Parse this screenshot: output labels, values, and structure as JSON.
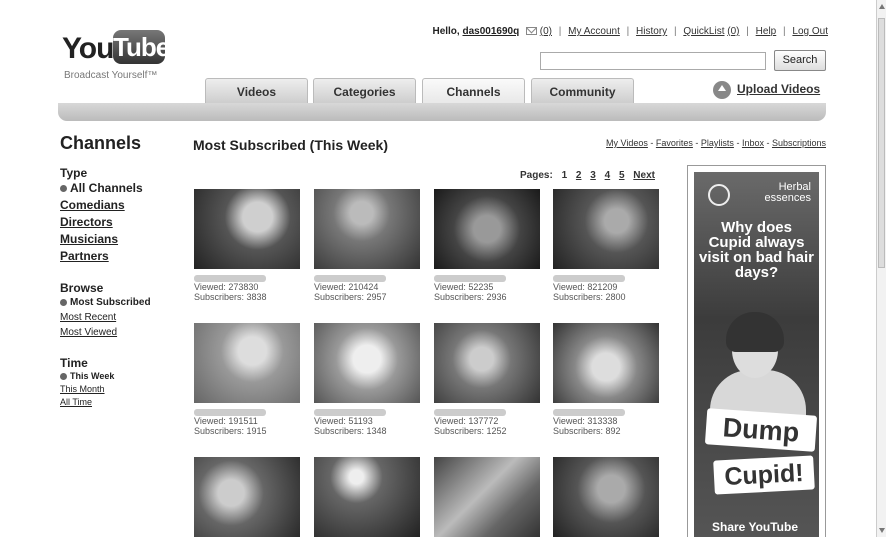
{
  "logo": {
    "you": "You",
    "tube": "Tube",
    "tagline": "Broadcast Yourself™"
  },
  "userbar": {
    "hello": "Hello,",
    "username": "das001690q",
    "inbox_count": "(0)",
    "my_account": "My Account",
    "history": "History",
    "quicklist": "QuickList",
    "quicklist_count": "(0)",
    "help": "Help",
    "logout": "Log Out"
  },
  "search": {
    "value": "",
    "button": "Search"
  },
  "tabs": [
    "Videos",
    "Categories",
    "Channels",
    "Community"
  ],
  "upload": "Upload Videos",
  "page_title": "Channels",
  "section_title": "Most Subscribed (This Week)",
  "sub_links": [
    "My Videos",
    "Favorites",
    "Playlists",
    "Inbox",
    "Subscriptions"
  ],
  "sidebar": {
    "type_head": "Type",
    "type_items": [
      "All Channels",
      "Comedians",
      "Directors",
      "Musicians",
      "Partners"
    ],
    "browse_head": "Browse",
    "browse_items": [
      "Most Subscribed",
      "Most Recent",
      "Most Viewed"
    ],
    "time_head": "Time",
    "time_items": [
      "This Week",
      "This Month",
      "All Time"
    ]
  },
  "pages": {
    "label": "Pages:",
    "items": [
      "1",
      "2",
      "3",
      "4",
      "5"
    ],
    "next": "Next"
  },
  "channels": [
    {
      "viewed": "Viewed: 273830",
      "subs": "Subscribers: 3838"
    },
    {
      "viewed": "Viewed: 210424",
      "subs": "Subscribers: 2957"
    },
    {
      "viewed": "Viewed: 52235",
      "subs": "Subscribers: 2936"
    },
    {
      "viewed": "Viewed: 821209",
      "subs": "Subscribers: 2800"
    },
    {
      "viewed": "Viewed: 191511",
      "subs": "Subscribers: 1915"
    },
    {
      "viewed": "Viewed: 51193",
      "subs": "Subscribers: 1348"
    },
    {
      "viewed": "Viewed: 137772",
      "subs": "Subscribers: 1252"
    },
    {
      "viewed": "Viewed: 313338",
      "subs": "Subscribers: 892"
    },
    {
      "viewed": "",
      "subs": ""
    },
    {
      "viewed": "",
      "subs": ""
    },
    {
      "viewed": "",
      "subs": ""
    },
    {
      "viewed": "",
      "subs": ""
    }
  ],
  "ad": {
    "brand_line1": "Herbal",
    "brand_line2": "essences",
    "headline": "Why does Cupid always visit on bad hair days?",
    "cta1": "Dump",
    "cta2": "Cupid!",
    "share": "Share YouTube"
  }
}
